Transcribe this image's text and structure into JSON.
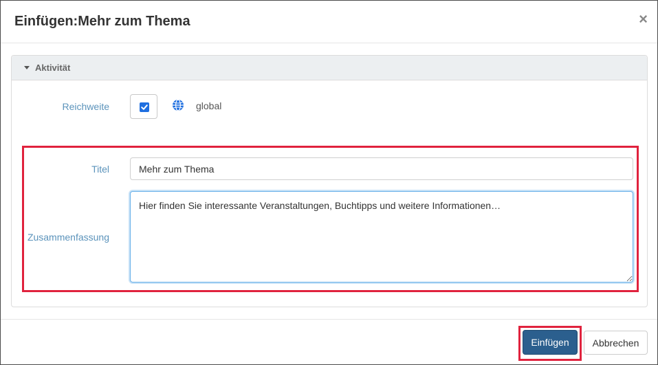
{
  "modal": {
    "title": "Einfügen:Mehr zum Thema",
    "close_glyph": "×"
  },
  "panel": {
    "title": "Aktivität"
  },
  "form": {
    "reach_label": "Reichweite",
    "reach_checked": true,
    "reach_value": "global",
    "title_label": "Titel",
    "title_value": "Mehr zum Thema",
    "summary_label": "Zusammenfassung",
    "summary_value": "Hier finden Sie interessante Veranstaltungen, Buchtipps und weitere Informationen…"
  },
  "footer": {
    "insert_label": "Einfügen",
    "cancel_label": "Abbrechen"
  },
  "colors": {
    "primary": "#2b5f8e",
    "label": "#5b93bb",
    "highlight": "#e0223d",
    "checkbox": "#1f6fe0"
  },
  "icons": {
    "close": "close-icon",
    "caret": "caret-down-icon",
    "checkbox": "checkmark-icon",
    "globe": "globe-icon"
  }
}
